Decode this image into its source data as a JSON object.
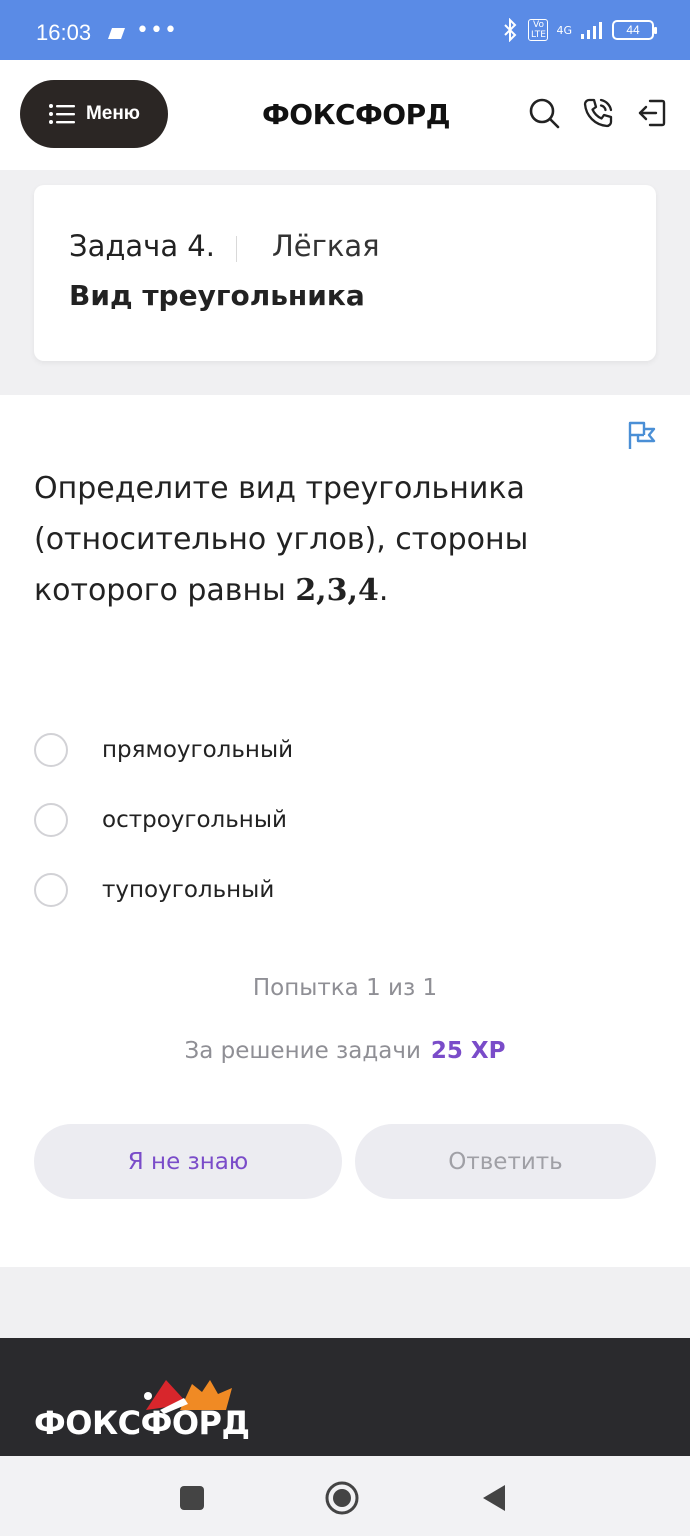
{
  "status_bar": {
    "time": "16:03",
    "dots": "•••",
    "network": "4G",
    "volte": "Vo LTE",
    "battery": "44"
  },
  "header": {
    "menu_label": "Меню",
    "logo": "ФОКСФОРД",
    "icons": [
      "search-icon",
      "phone-icon",
      "logout-icon"
    ]
  },
  "task": {
    "number": "Задача 4.",
    "level": "Лёгкая",
    "title": "Вид треугольника"
  },
  "question": {
    "text": "Определите вид треугольника (относительно углов), стороны которого равны ",
    "math": "2,3,4",
    "end": "."
  },
  "options": [
    {
      "label": "прямоугольный",
      "selected": false
    },
    {
      "label": "остроугольный",
      "selected": false
    },
    {
      "label": "тупоугольный",
      "selected": false
    }
  ],
  "attempt": "Попытка 1 из 1",
  "reward": {
    "text": "За решение задачи",
    "xp": "25 XP"
  },
  "buttons": {
    "dont_know": "Я не знаю",
    "answer": "Ответить"
  },
  "footer": {
    "logo": "ФОКСФОРД"
  },
  "colors": {
    "accent": "#7a4cc9",
    "status_bar": "#5a8be6",
    "menu_button": "#2b2624",
    "footer": "#2a2a2d"
  }
}
